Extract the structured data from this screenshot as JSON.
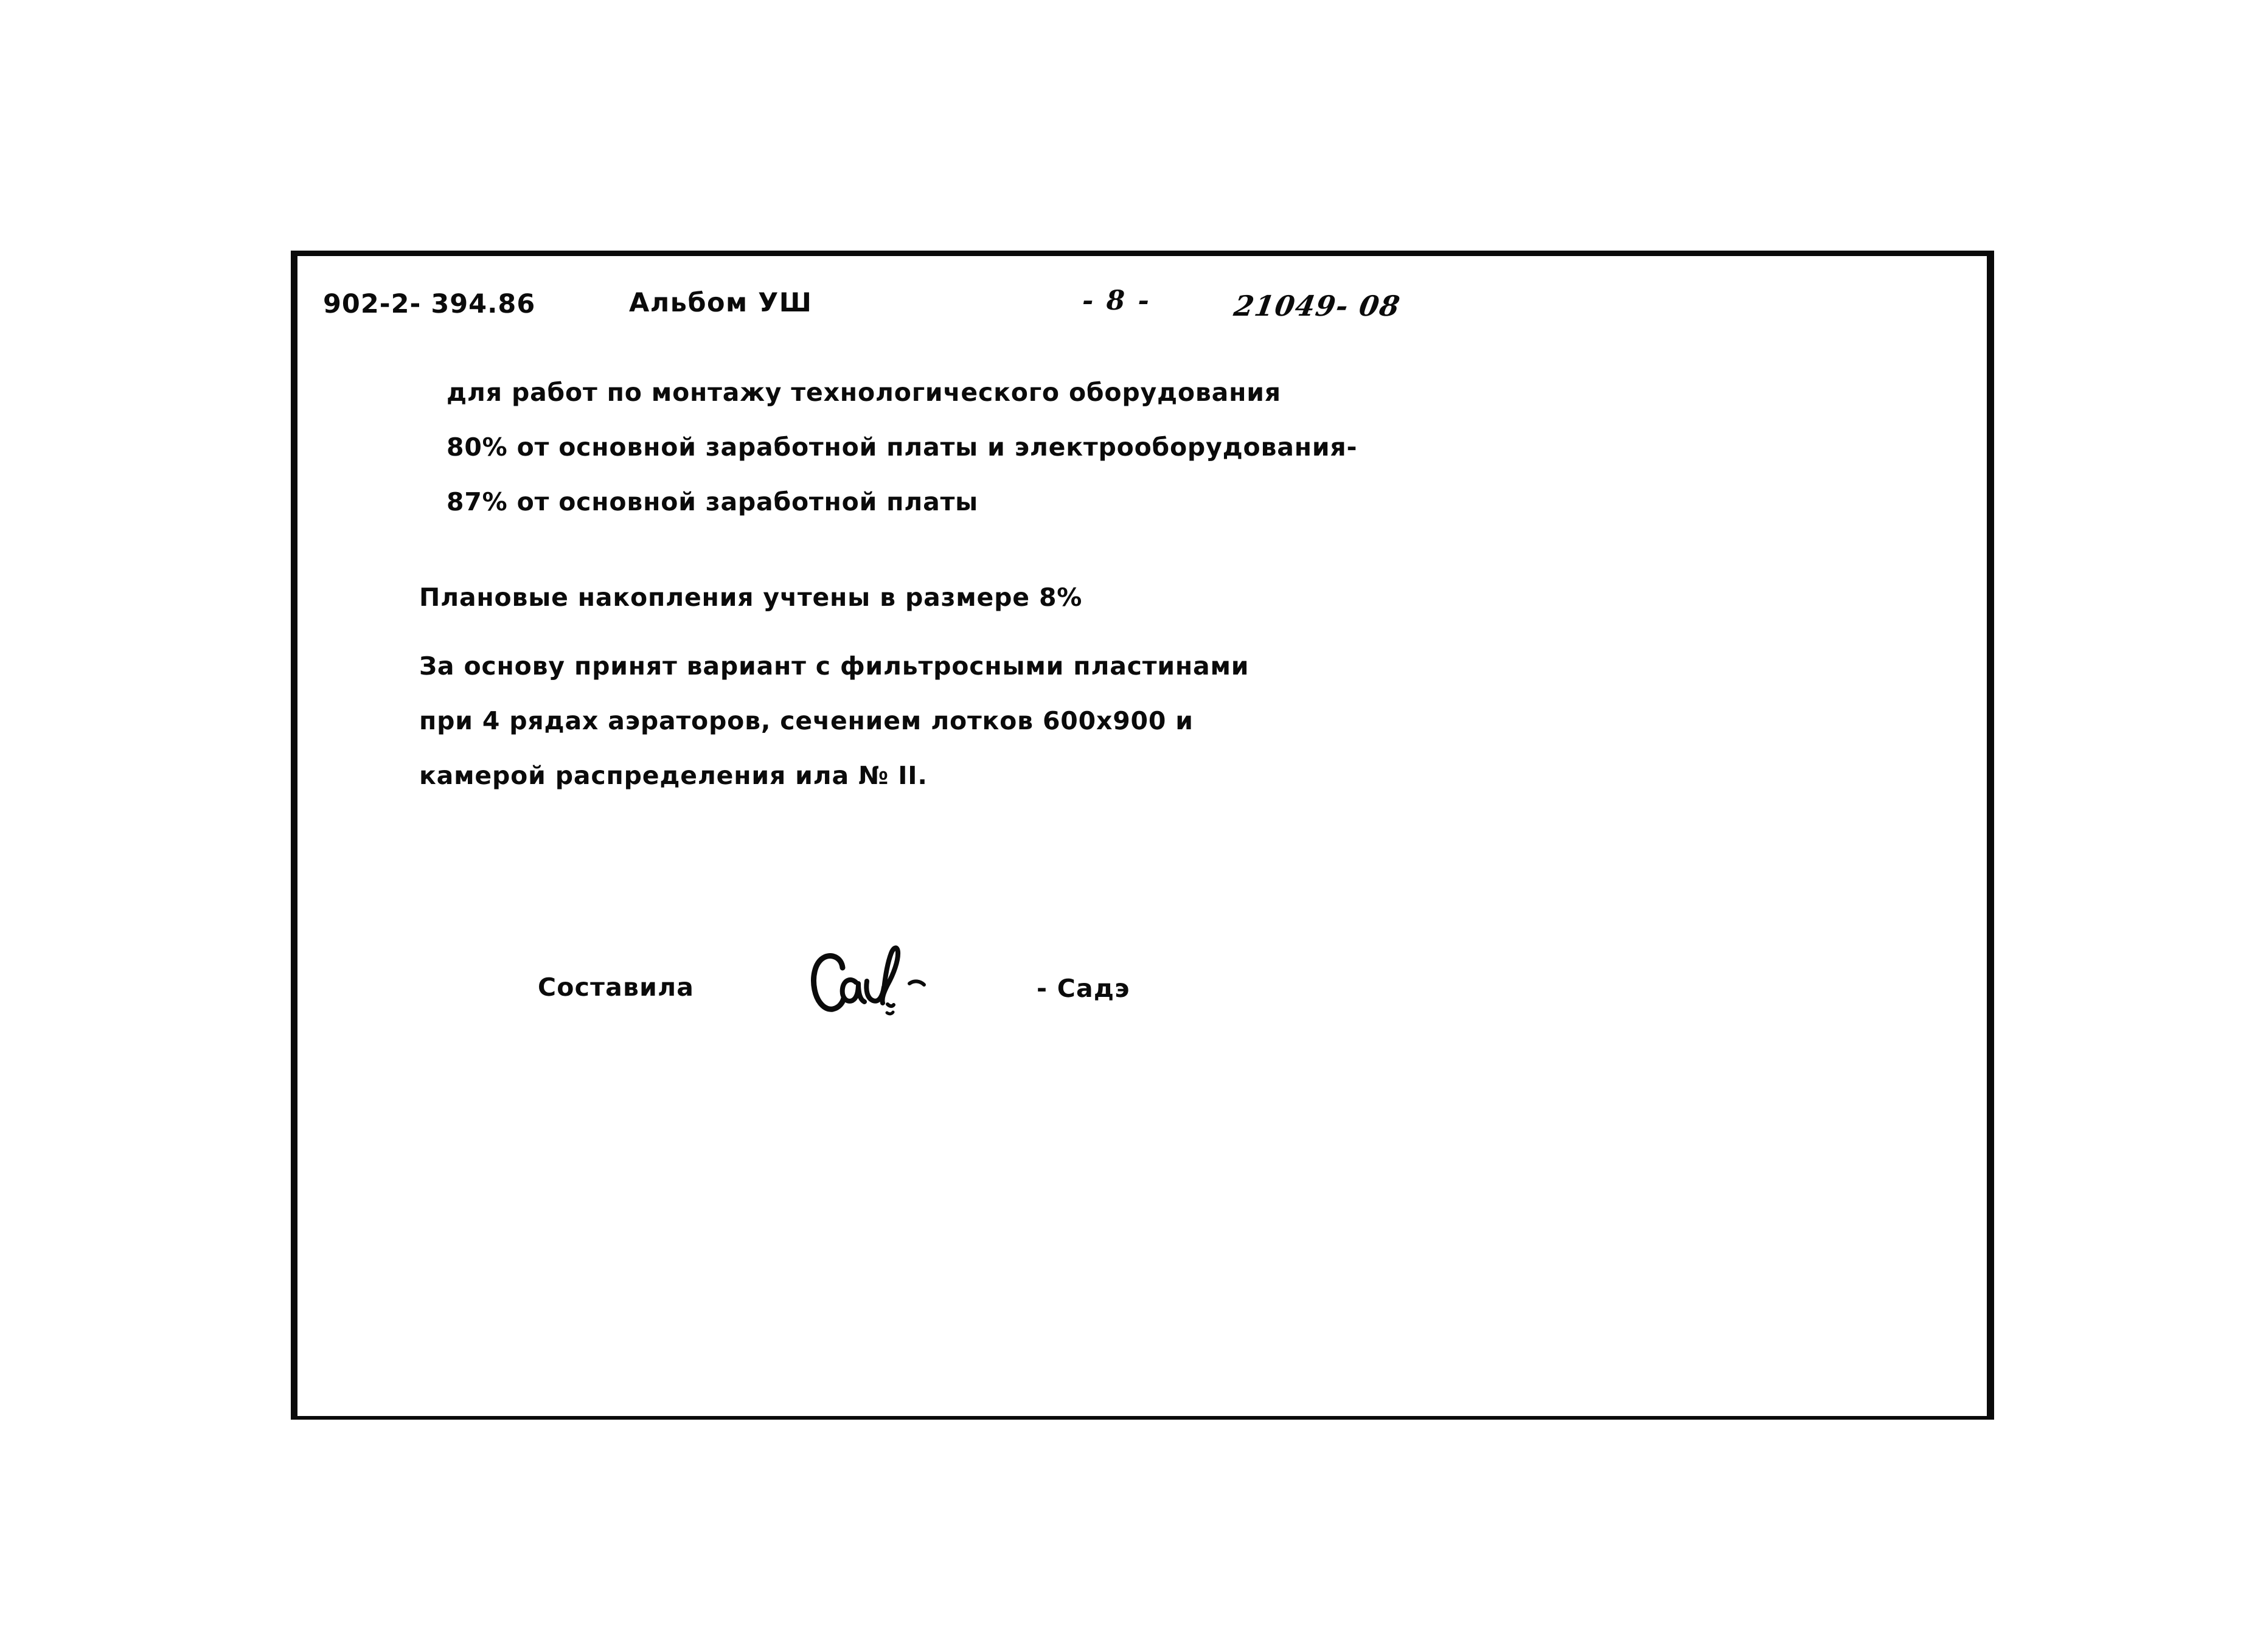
{
  "page": {
    "background_color": "#ffffff",
    "frame_color": "#0a0a0a"
  },
  "header": {
    "doc_code": "902-2- 394.86",
    "album_label": "Альбом УШ",
    "page_number": "- 8 -",
    "drawing_number": "21049- 08"
  },
  "body": {
    "continuation_block": [
      "для работ по монтажу технологического оборудования",
      "80% от основной заработной платы и электрооборудования-",
      "87% от основной заработной платы"
    ],
    "paragraph_2": [
      "Плановые накопления учтены в размере 8%"
    ],
    "paragraph_3": [
      "За основу принят вариант с фильтросными пластинами",
      "при 4 рядах аэраторов, сечением лотков 600х900 и",
      "камерой распределения ила № II."
    ]
  },
  "signature": {
    "compiled_by_label": "Составила",
    "signature_glyph": "handwritten-signature",
    "author_name": "- Садэ"
  }
}
